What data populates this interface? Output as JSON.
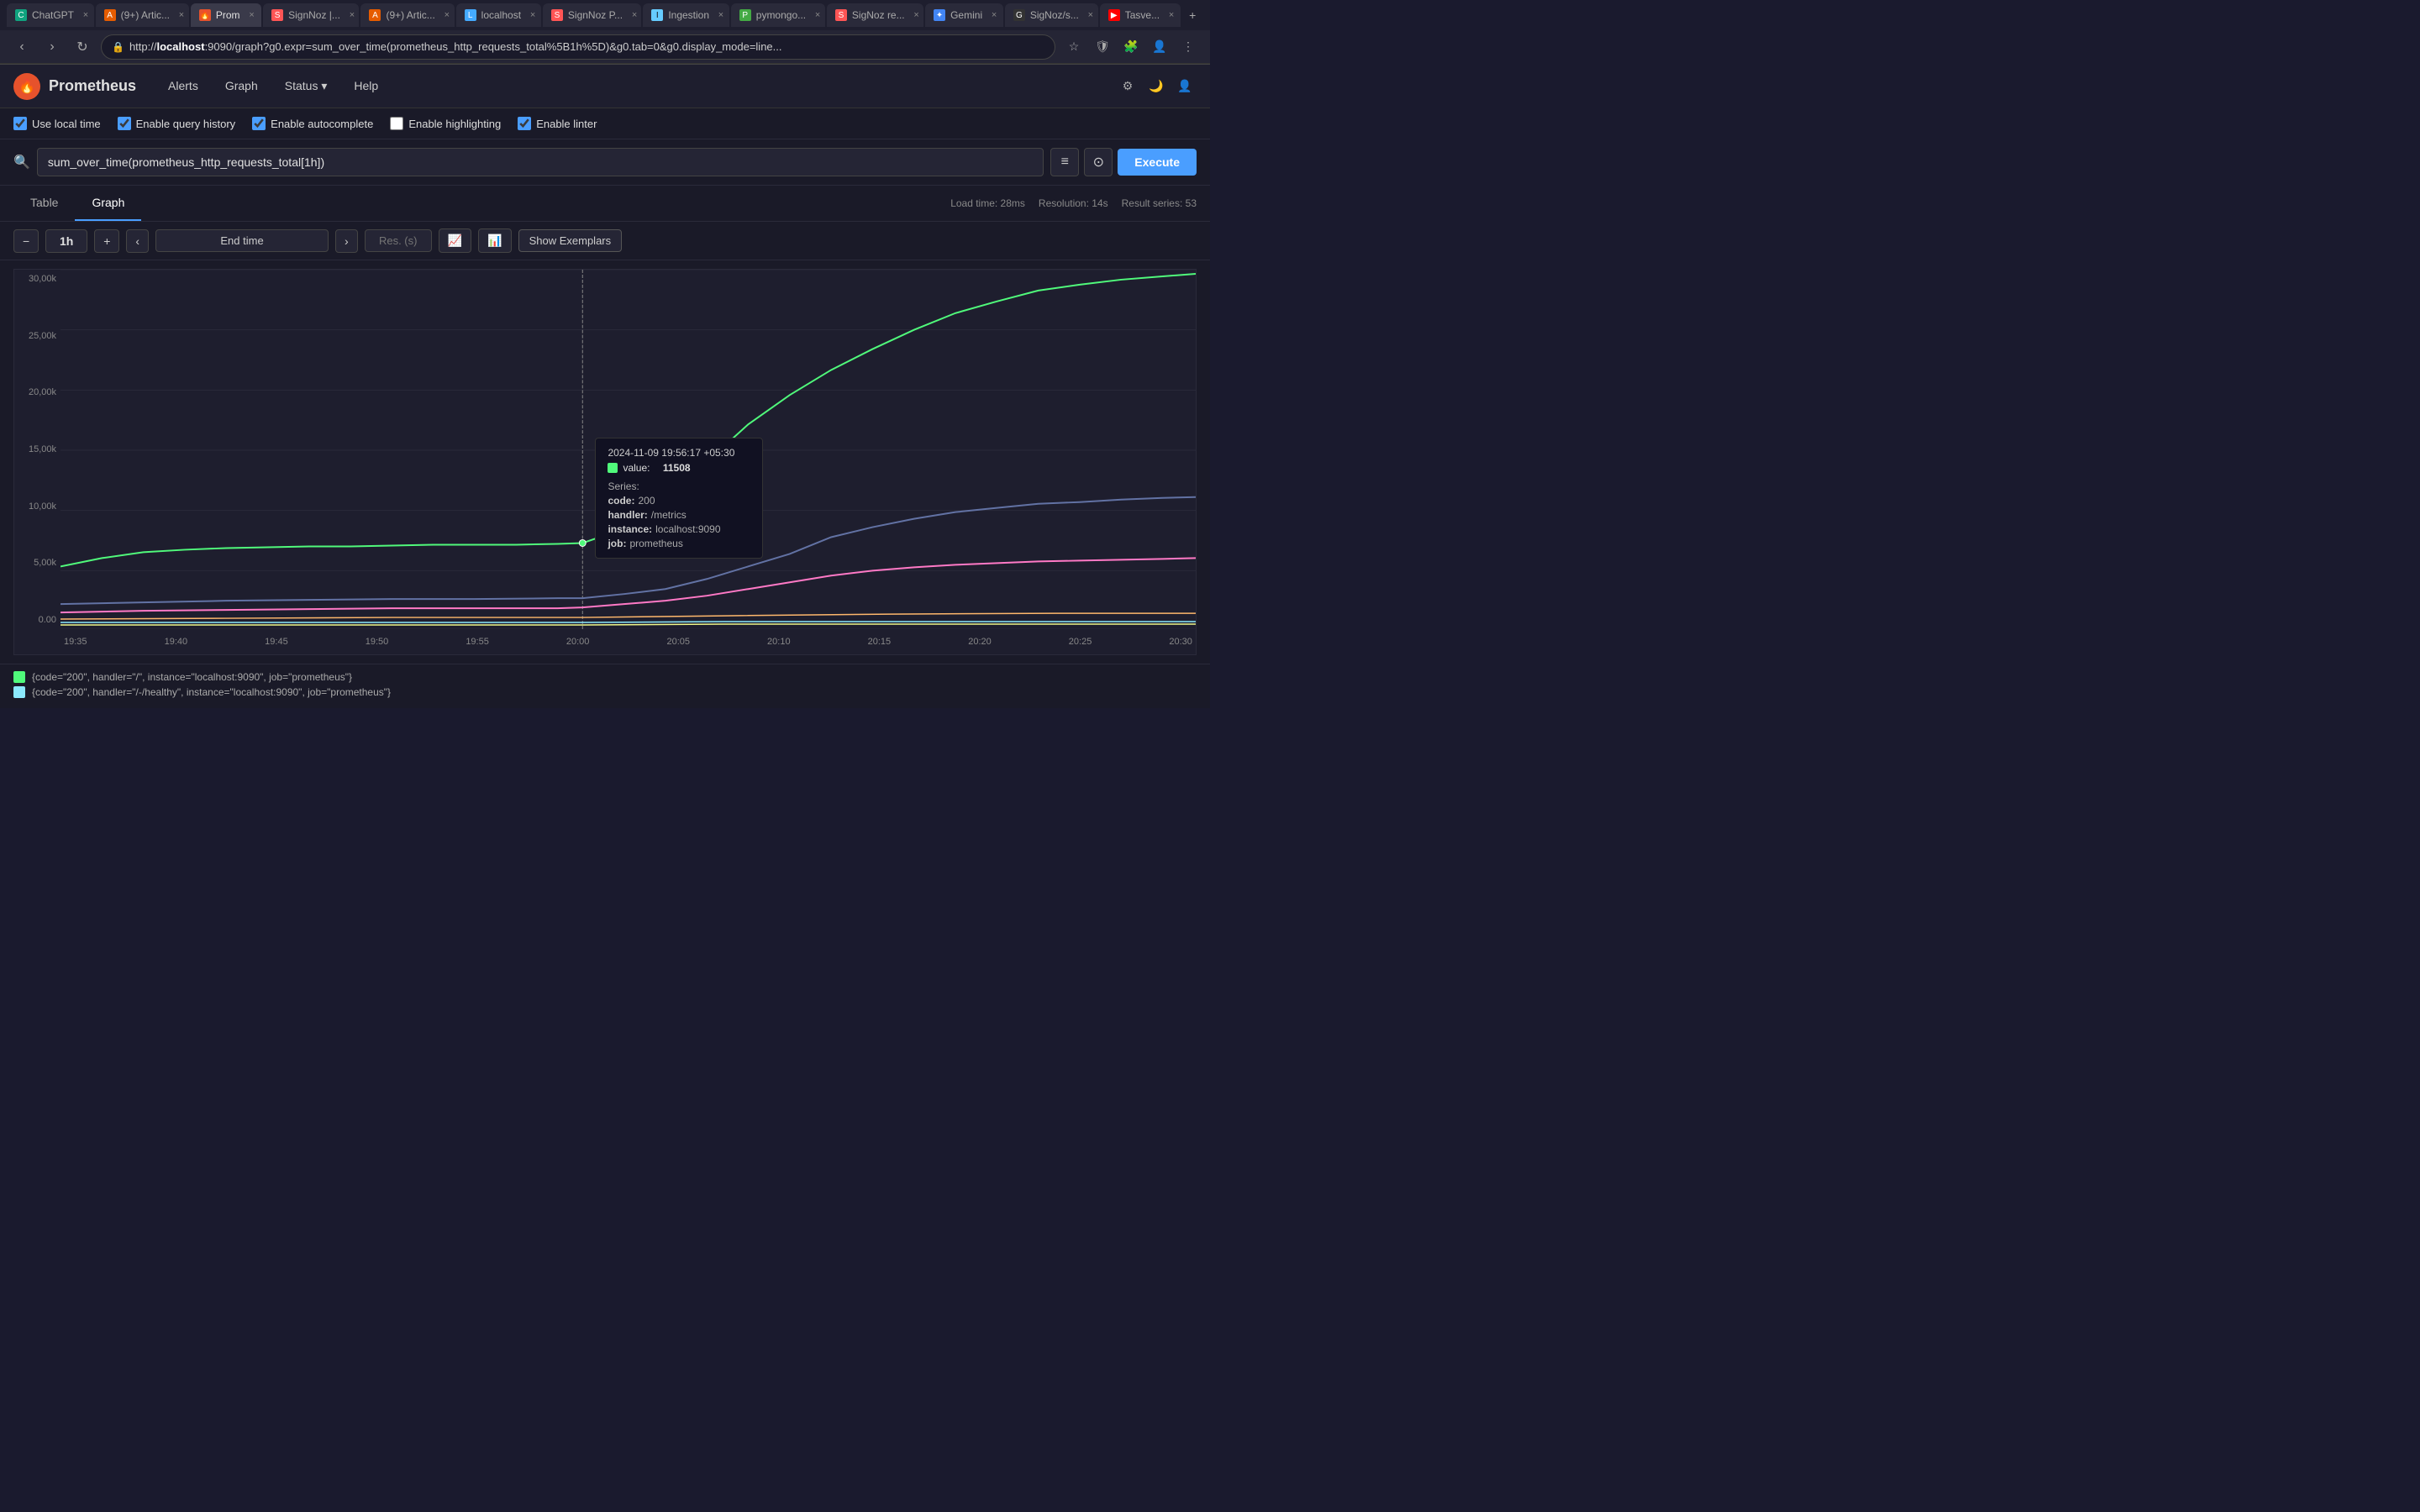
{
  "browser": {
    "tabs": [
      {
        "id": "chatgpt",
        "label": "ChatGPT",
        "favicon_color": "#10a37f",
        "favicon_text": "C",
        "active": false
      },
      {
        "id": "articles1",
        "label": "(9+) Artic...",
        "favicon_color": "#e65c00",
        "favicon_text": "A",
        "active": false
      },
      {
        "id": "prometheus",
        "label": "Prom",
        "favicon_color": "#e6522c",
        "favicon_text": "🔥",
        "active": true
      },
      {
        "id": "signoz1",
        "label": "SignNoz |...",
        "favicon_color": "#f55",
        "favicon_text": "S",
        "active": false
      },
      {
        "id": "articles2",
        "label": "(9+) Artic...",
        "favicon_color": "#e65c00",
        "favicon_text": "A",
        "active": false
      },
      {
        "id": "localhost",
        "label": "localhost",
        "favicon_color": "#4af",
        "favicon_text": "L",
        "active": false
      },
      {
        "id": "signozp",
        "label": "SignNoz P...",
        "favicon_color": "#f55",
        "favicon_text": "S",
        "active": false
      },
      {
        "id": "ingestion",
        "label": "Ingestion",
        "favicon_color": "#6cf",
        "favicon_text": "I",
        "active": false
      },
      {
        "id": "pymongo",
        "label": "pymongo...",
        "favicon_color": "#4a4",
        "favicon_text": "P",
        "active": false
      },
      {
        "id": "signozr",
        "label": "SigNoz re...",
        "favicon_color": "#f55",
        "favicon_text": "S",
        "active": false
      },
      {
        "id": "gemini",
        "label": "Gemini",
        "favicon_color": "#4285f4",
        "favicon_text": "✦",
        "active": false
      },
      {
        "id": "signozs",
        "label": "SigNoz/s...",
        "favicon_color": "#333",
        "favicon_text": "G",
        "active": false
      },
      {
        "id": "tasve",
        "label": "Tasve...",
        "favicon_color": "#f00",
        "favicon_text": "▶",
        "active": false
      }
    ],
    "url": "http://localhost:9090/graph?g0.expr=sum_over_time(prometheus_http_requests_total%5B1h%5D)&g0.tab=0&g0.display_mode=line...",
    "url_host": "localhost",
    "url_port": ":9090"
  },
  "prometheus": {
    "title": "Prometheus",
    "nav_items": [
      "Alerts",
      "Graph",
      "Status",
      "Help"
    ],
    "options": {
      "use_local_time": {
        "label": "Use local time",
        "checked": true
      },
      "enable_query_history": {
        "label": "Enable query history",
        "checked": true
      },
      "enable_autocomplete": {
        "label": "Enable autocomplete",
        "checked": true
      },
      "enable_highlighting": {
        "label": "Enable highlighting",
        "checked": false
      },
      "enable_linter": {
        "label": "Enable linter",
        "checked": true
      }
    },
    "query": "sum_over_time(prometheus_http_requests_total[1h])",
    "execute_label": "Execute",
    "tabs": [
      "Table",
      "Graph"
    ],
    "active_tab": "Graph",
    "stats": {
      "load_time": "Load time: 28ms",
      "resolution": "Resolution: 14s",
      "result_series": "Result series: 53"
    },
    "graph": {
      "duration": "1h",
      "end_time": "End time",
      "res_placeholder": "Res. (s)",
      "show_exemplars": "Show Exemplars",
      "y_labels": [
        "30,00k",
        "25,00k",
        "20,00k",
        "15,00k",
        "10,00k",
        "5,00k",
        "0.00"
      ],
      "x_labels": [
        "19:35",
        "19:40",
        "19:45",
        "19:50",
        "19:55",
        "20:00",
        "20:05",
        "20:10",
        "20:15",
        "20:20",
        "20:25",
        "20:30"
      ],
      "tooltip": {
        "time": "2024-11-09 19:56:17 +05:30",
        "value_label": "value:",
        "value": "11508",
        "dot_color": "#50fa7b",
        "series_label": "Series:",
        "code": "200",
        "handler": "/metrics",
        "instance": "localhost:9090",
        "job": "prometheus"
      }
    },
    "legend": [
      {
        "label": "{code=\"200\", handler=\"/\", instance=\"localhost:9090\", job=\"prometheus\"}",
        "color": "#50fa7b"
      },
      {
        "label": "{code=\"200\", handler=\"/-/healthy\", instance=\"localhost:9090\", job=\"prometheus\"}",
        "color": "#8be9fd"
      }
    ]
  }
}
